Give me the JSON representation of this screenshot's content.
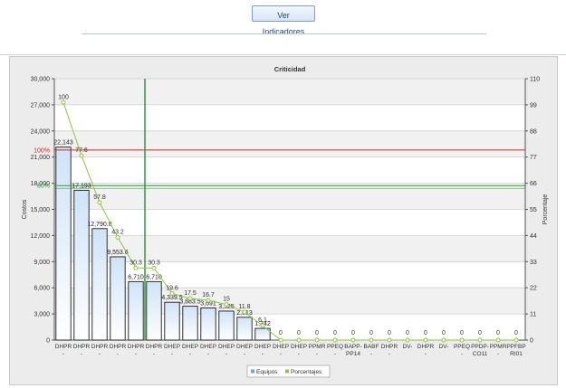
{
  "toolbar": {
    "button_label": "Ver Indicadores"
  },
  "chart_data": {
    "type": "bar",
    "title": "Criticidad",
    "ylabel": "Costos",
    "y2label": "Porcentaje",
    "ylim": [
      0,
      30000
    ],
    "y2lim": [
      0,
      110
    ],
    "yticks": [
      "0",
      "3,000",
      "6,000",
      "9,000",
      "12,000",
      "15,000",
      "18,000",
      "21,000",
      "24,000",
      "27,000",
      "30,000"
    ],
    "y2ticks": [
      "0",
      "11",
      "22",
      "33",
      "44",
      "55",
      "66",
      "77",
      "88",
      "99",
      "110"
    ],
    "categories": [
      [
        "DHPR",
        "-"
      ],
      [
        "DHPR",
        "-"
      ],
      [
        "DHPR",
        "-"
      ],
      [
        "DHPR",
        "-"
      ],
      [
        "DHPR",
        "-"
      ],
      [
        "DHPR",
        "-"
      ],
      [
        "DHEP",
        "-"
      ],
      [
        "DHEP",
        "-"
      ],
      [
        "DHEP",
        "-"
      ],
      [
        "DHEP",
        "-"
      ],
      [
        "DHEP",
        "-"
      ],
      [
        "DHEP",
        "-"
      ],
      [
        "DHEP",
        "-"
      ],
      [
        "DHEP",
        "-"
      ],
      [
        "PPMR",
        "-"
      ],
      [
        "PPEQ",
        "-"
      ],
      [
        "BAPP-",
        "PP14"
      ],
      [
        "BABF",
        "-"
      ],
      [
        "DHPR",
        "-"
      ],
      [
        "DV-",
        ""
      ],
      [
        "DHPR",
        "-"
      ],
      [
        "DV-",
        ""
      ],
      [
        "PPEQ",
        "-"
      ],
      [
        "PPDP-",
        "CO11"
      ],
      [
        "PPMR",
        "-"
      ],
      [
        "PPFBP",
        "RI01"
      ]
    ],
    "series": [
      {
        "name": "Equipos",
        "color": "#6aa6dc",
        "values": [
          22143,
          17193,
          12790.8,
          9553.6,
          6710,
          6710,
          4339.5,
          3883.5,
          3691,
          3325,
          2613,
          1342,
          0,
          0,
          0,
          0,
          0,
          0,
          0,
          0,
          0,
          0,
          0,
          0,
          0,
          0
        ],
        "labels": [
          "22,143",
          "17,193",
          "12,790.8",
          "9,553.6",
          "6,710",
          "6,710",
          "4,339.5",
          "3,883.5",
          "3,691",
          "3,325",
          "2,613",
          "1,342",
          "",
          "",
          "",
          "",
          "",
          "",
          "",
          "",
          "",
          "",
          "",
          "",
          "",
          ""
        ]
      },
      {
        "name": "Porcentajes",
        "color": "#8ec641",
        "values": [
          100,
          77.6,
          57.9,
          43.2,
          30.3,
          30.3,
          19.6,
          17.5,
          16.7,
          15,
          11.8,
          6.1,
          0,
          0,
          0,
          0,
          0,
          0,
          0,
          0,
          0,
          0,
          0,
          0,
          0,
          0
        ],
        "labels": [
          "100",
          "77.6",
          "57.8",
          "43.2",
          "30.3",
          "30.3",
          "19.6",
          "17.5",
          "16.7",
          "15",
          "11.8",
          "6.1",
          "0",
          "0",
          "0",
          "0",
          "0",
          "0",
          "0",
          "0",
          "0",
          "0",
          "0",
          "0",
          "0",
          "0"
        ]
      }
    ],
    "reference_lines": [
      {
        "label": "100%",
        "value": 80,
        "axis": "y2",
        "color": "#e02020"
      },
      {
        "label": "80%",
        "value": 65,
        "axis": "y2",
        "color": "#2a9a3a"
      }
    ],
    "vertical_marker_category_index": 4,
    "grid": true,
    "legend_position": "bottom-center"
  }
}
